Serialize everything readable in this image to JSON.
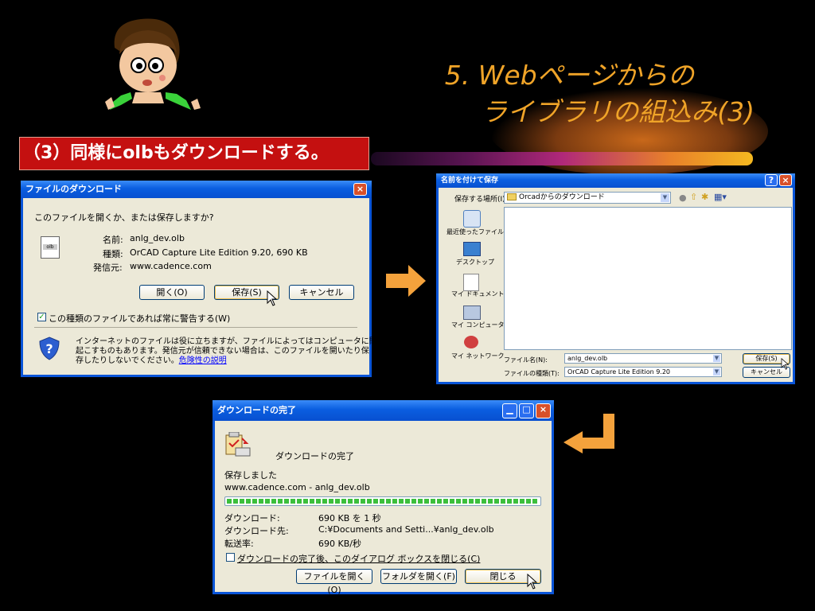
{
  "slide": {
    "title_line1": "5. Webページからの",
    "title_line2": "ライブラリの組込み(3)",
    "step": "（3）同様にolbもダウンロードする。",
    "accent": "#f0a428"
  },
  "file_download": {
    "title": "ファイルのダウンロード",
    "question": "このファイルを開くか、または保存しますか?",
    "name_label": "名前:",
    "name_value": "anlg_dev.olb",
    "type_label": "種類:",
    "type_value": "OrCAD Capture Lite Edition 9.20, 690 KB",
    "from_label": "発信元:",
    "from_value": "www.cadence.com",
    "open_btn": "開く(O)",
    "save_btn": "保存(S)",
    "cancel_btn": "キャンセル",
    "always_ask": "この種類のファイルであれば常に警告する(W)",
    "warning_line1": "インターネットのファイルは役に立ちますが、ファイルによってはコンピュータに問題を",
    "warning_line2": "起こすものもあります。発信元が信頼できない場合は、このファイルを開いたり保",
    "warning_line3": "存したりしないでください。",
    "warning_link": "危険性の説明",
    "close_icon": "×",
    "file_icon_label": "olb"
  },
  "save_as": {
    "title": "名前を付けて保存",
    "help_icon": "?",
    "close_icon": "×",
    "location_label": "保存する場所(I):",
    "location_value": "Orcadからのダウンロード",
    "places": [
      {
        "label": "最近使ったファイル",
        "icon": "recent-files-icon"
      },
      {
        "label": "デスクトップ",
        "icon": "desktop-icon"
      },
      {
        "label": "マイ ドキュメント",
        "icon": "my-documents-icon"
      },
      {
        "label": "マイ コンピュータ",
        "icon": "my-computer-icon"
      },
      {
        "label": "マイ ネットワーク",
        "icon": "my-network-icon"
      }
    ],
    "filename_label": "ファイル名(N):",
    "filename_value": "anlg_dev.olb",
    "filetype_label": "ファイルの種類(T):",
    "filetype_value": "OrCAD Capture Lite Edition 9.20",
    "save_btn": "保存(S)",
    "cancel_btn": "キャンセル"
  },
  "download_complete": {
    "title": "ダウンロードの完了",
    "heading": "ダウンロードの完了",
    "saved": "保存しました",
    "source": "www.cadence.com - anlg_dev.olb",
    "progress": 1.0,
    "dl_label": "ダウンロード:",
    "dl_value": "690 KB を 1 秒",
    "dest_label": "ダウンロード先:",
    "dest_value": "C:¥Documents and Setti...¥anlg_dev.olb",
    "rate_label": "転送率:",
    "rate_value": "690 KB/秒",
    "close_after": "ダウンロードの完了後、このダイアログ ボックスを閉じる(C)",
    "open_file_btn": "ファイルを開く(O)",
    "open_folder_btn": "フォルダを開く(F)",
    "close_btn": "閉じる"
  }
}
